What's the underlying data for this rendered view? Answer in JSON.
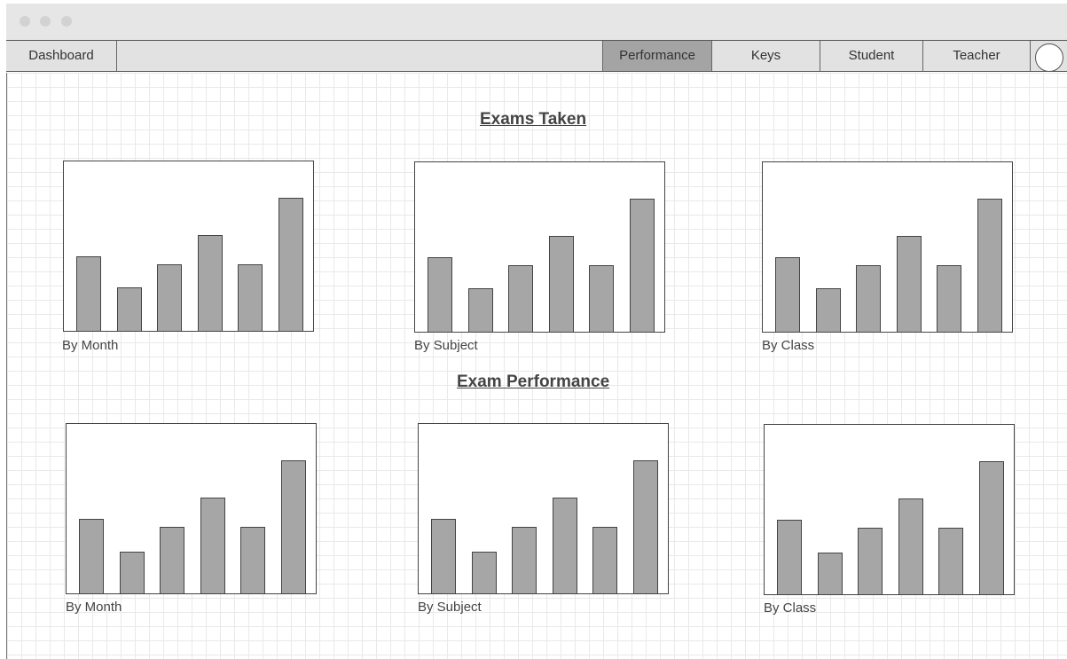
{
  "window": {
    "controls": [
      "close",
      "minimize",
      "maximize"
    ]
  },
  "navbar": {
    "dashboard_label": "Dashboard",
    "tabs": [
      {
        "label": "Performance",
        "active": true
      },
      {
        "label": "Keys",
        "active": false
      },
      {
        "label": "Student",
        "active": false
      },
      {
        "label": "Teacher",
        "active": false
      }
    ],
    "avatar_icon": "user-avatar-icon"
  },
  "sections": [
    {
      "title": "Exams Taken",
      "charts": [
        {
          "caption": "By Month"
        },
        {
          "caption": "By Subject"
        },
        {
          "caption": "By Class"
        }
      ]
    },
    {
      "title": "Exam Performance",
      "charts": [
        {
          "caption": "By Month"
        },
        {
          "caption": "By Subject"
        },
        {
          "caption": "By Class"
        }
      ]
    }
  ],
  "chart_data": [
    {
      "type": "bar",
      "title": "",
      "xlabel": "By Month",
      "ylabel": "",
      "values": [
        45,
        26,
        40,
        58,
        40,
        80
      ],
      "ylim": [
        0,
        100
      ]
    },
    {
      "type": "bar",
      "title": "",
      "xlabel": "By Subject",
      "ylabel": "",
      "values": [
        45,
        26,
        40,
        58,
        40,
        80
      ],
      "ylim": [
        0,
        100
      ]
    },
    {
      "type": "bar",
      "title": "",
      "xlabel": "By Class",
      "ylabel": "",
      "values": [
        45,
        26,
        40,
        58,
        40,
        80
      ],
      "ylim": [
        0,
        100
      ]
    },
    {
      "type": "bar",
      "title": "",
      "xlabel": "By Month",
      "ylabel": "",
      "values": [
        45,
        25,
        40,
        58,
        40,
        80
      ],
      "ylim": [
        0,
        100
      ]
    },
    {
      "type": "bar",
      "title": "",
      "xlabel": "By Subject",
      "ylabel": "",
      "values": [
        45,
        25,
        40,
        58,
        40,
        80
      ],
      "ylim": [
        0,
        100
      ]
    },
    {
      "type": "bar",
      "title": "",
      "xlabel": "By Class",
      "ylabel": "",
      "values": [
        45,
        25,
        40,
        58,
        40,
        80
      ],
      "ylim": [
        0,
        100
      ]
    }
  ],
  "colors": {
    "bar_fill": "#a6a6a6",
    "active_tab": "#a4a4a4",
    "navbar_bg": "#e2e2e2"
  }
}
